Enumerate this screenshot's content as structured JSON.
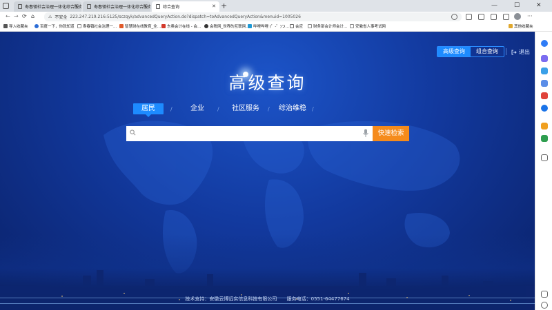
{
  "browser": {
    "tabs": [
      {
        "title": "寿春镇社会治理一体化综合服务…",
        "active": false
      },
      {
        "title": "寿春镇社会治理一体化综合服务…",
        "active": false
      },
      {
        "title": "综合查询",
        "active": true
      }
    ],
    "new_tab": "+",
    "window": {
      "minimize": "—",
      "maximize": "☐",
      "close": "✕"
    },
    "nav": {
      "back": "←",
      "forward": "→",
      "reload": "⟳",
      "home": "⌂"
    },
    "security": "不安全",
    "url": "223.247.219.216:5125/sczqyk/advancedQueryAction.do?dispatch=toAdvancedQueryAction&menuid=1005026",
    "bookmarks": [
      {
        "label": "导入收藏夹",
        "color": "#555555"
      },
      {
        "label": "百度一下，你就知道",
        "color": "#2b6cd6"
      },
      {
        "label": "寿春镇社会治理一…",
        "color": "#888888"
      },
      {
        "label": "智慧财在线教育_全…",
        "color": "#e05a2a"
      },
      {
        "label": "东奥会计在线 - 会…",
        "color": "#d33a2c"
      },
      {
        "label": "会税网_世界的互联网…",
        "color": "#333333"
      },
      {
        "label": "哔哩哔哩 (゜-゜)つ…",
        "color": "#1e9ad6"
      },
      {
        "label": "会应",
        "color": "#666666"
      },
      {
        "label": "财务部会计师会计…",
        "color": "#888888"
      },
      {
        "label": "安徽省人事考试网",
        "color": "#888888"
      },
      {
        "label": "其他收藏夹",
        "color": "#e0a82e"
      }
    ]
  },
  "page": {
    "toggle": {
      "advanced": "高级查询",
      "combined": "组合查询"
    },
    "logout": "退出",
    "title": "高级查询",
    "categories": [
      {
        "label": "居民",
        "active": true
      },
      {
        "label": "企业",
        "active": false
      },
      {
        "label": "社区服务",
        "active": false
      },
      {
        "label": "综治维稳",
        "active": false
      }
    ],
    "search": {
      "placeholder": "",
      "value": "",
      "button": "快速检索"
    },
    "footer": {
      "support": "技术支持：安徽云博远实信息科技有限公司",
      "phone": "服务电话：0551-64477674"
    }
  },
  "colors": {
    "accent": "#1d8bff",
    "search_button": "#f58b1c",
    "background": "#12399e"
  }
}
